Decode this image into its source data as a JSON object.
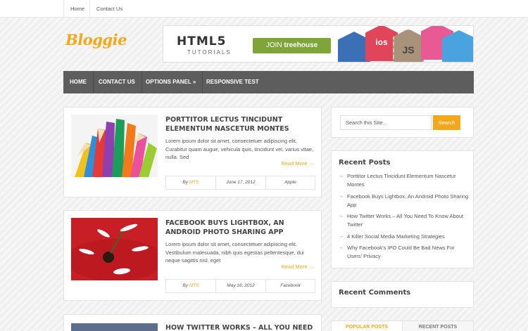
{
  "topbar": {
    "home": "Home",
    "contact": "Contact Us"
  },
  "logo": "Bloggie",
  "banner": {
    "headline": "HTML5",
    "subline": "TUTORIALS",
    "cta_join": "JOIN",
    "cta_brand": "treehouse",
    "badges": [
      "ios",
      "JS"
    ]
  },
  "nav": [
    "HOME",
    "CONTACT US",
    "OPTIONS PANEL »",
    "RESPONSIVE TEST"
  ],
  "posts": [
    {
      "title": "PORTTITOR LECTUS TINCIDUNT ELEMENTUM NASCETUR MONTES",
      "excerpt": "Lorem ipsum dolor sit amet, consectetuer adipiscing elit. Curabitur quam augue, vehicula quis, tincidunt vel, varius vitae, nulla. Sed",
      "read_more": "Read More →",
      "by": "By",
      "author": "MTS",
      "date": "June 17, 2012",
      "category": "Apple"
    },
    {
      "title": "FACEBOOK BUYS LIGHTBOX, AN ANDROID PHOTO SHARING APP",
      "excerpt": "Lorem ipsum dolor sit amet, consectetuer adipiscing elit. Vestibulum malesuada, nibh quis egestas pellentesque, dui neque sagittis nisl, eget",
      "read_more": "Read More →",
      "by": "By",
      "author": "MTS",
      "date": "May 16, 2012",
      "category": "Facebook"
    },
    {
      "title": "HOW TWITTER WORKS – ALL YOU NEED TO"
    }
  ],
  "sidebar": {
    "search_placeholder": "Search this Site...",
    "search_button": "Search",
    "recent_posts_title": "Recent Posts",
    "recent_posts": [
      "Porttitor Lectus Tincidunt Elementum Nascetur Montes",
      "Facebook Buys Lightbox, An Android Photo Sharing App",
      "How Twitter Works – All You Need To Know About Twitter",
      "4 Killer Social Media Marketing Strategies",
      "Why Facebook's IPO Could Be Bad News For Users' Privacy"
    ],
    "recent_comments_title": "Recent Comments",
    "tab_popular": "POPULAR POSTS",
    "tab_recent": "RECENT POSTS"
  },
  "colors": {
    "accent": "#f3a81c",
    "nav": "#5d5d5d",
    "cta": "#7ea43a"
  }
}
